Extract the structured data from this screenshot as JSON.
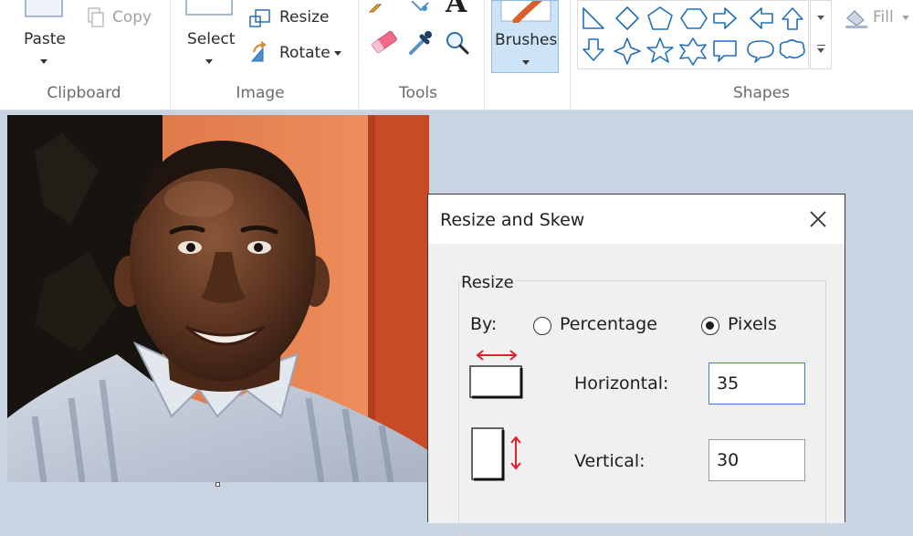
{
  "ribbon": {
    "clipboard": {
      "paste_label": "Paste",
      "copy_label": "Copy",
      "group_label": "Clipboard"
    },
    "image": {
      "select_label": "Select",
      "resize_label": "Resize",
      "rotate_label": "Rotate",
      "group_label": "Image"
    },
    "tools": {
      "group_label": "Tools",
      "text_glyph": "A"
    },
    "brushes": {
      "label": "Brushes"
    },
    "shapes": {
      "group_label": "Shapes",
      "fill_label": "Fill"
    }
  },
  "dialog": {
    "title": "Resize and Skew",
    "resize": {
      "legend": "Resize",
      "by_label": "By:",
      "options": [
        "Percentage",
        "Pixels"
      ],
      "selected": "Pixels",
      "horizontal_label": "Horizontal:",
      "horizontal_value": "35",
      "vertical_label": "Vertical:",
      "vertical_value": "30"
    }
  },
  "colors": {
    "accent": "#3c7fd1",
    "canvas_background": "#c9d4e3",
    "shape_outline": "#1f6fbd",
    "resize_arrow": "#e0202a"
  }
}
